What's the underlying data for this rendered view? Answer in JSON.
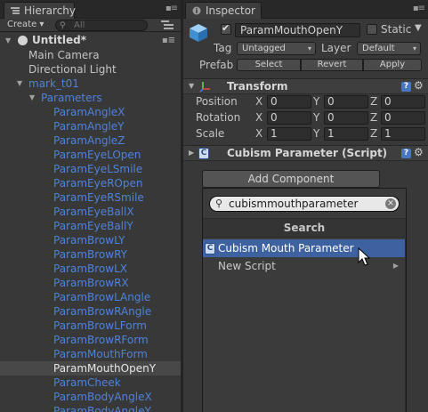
{
  "hierarchy": {
    "tab_label": "Hierarchy",
    "create_label": "Create",
    "search_placeholder": "All",
    "scene": "Untitled*",
    "items": [
      {
        "label": "Main Camera",
        "depth": 1,
        "blue": false,
        "fold": "",
        "selected": false
      },
      {
        "label": "Directional Light",
        "depth": 1,
        "blue": false,
        "fold": "",
        "selected": false
      },
      {
        "label": "mark_t01",
        "depth": 1,
        "blue": true,
        "fold": "open",
        "selected": false
      },
      {
        "label": "Parameters",
        "depth": 2,
        "blue": true,
        "fold": "open",
        "selected": false
      },
      {
        "label": "ParamAngleX",
        "depth": 3,
        "blue": true,
        "fold": "",
        "selected": false
      },
      {
        "label": "ParamAngleY",
        "depth": 3,
        "blue": true,
        "fold": "",
        "selected": false
      },
      {
        "label": "ParamAngleZ",
        "depth": 3,
        "blue": true,
        "fold": "",
        "selected": false
      },
      {
        "label": "ParamEyeLOpen",
        "depth": 3,
        "blue": true,
        "fold": "",
        "selected": false
      },
      {
        "label": "ParamEyeLSmile",
        "depth": 3,
        "blue": true,
        "fold": "",
        "selected": false
      },
      {
        "label": "ParamEyeROpen",
        "depth": 3,
        "blue": true,
        "fold": "",
        "selected": false
      },
      {
        "label": "ParamEyeRSmile",
        "depth": 3,
        "blue": true,
        "fold": "",
        "selected": false
      },
      {
        "label": "ParamEyeBallX",
        "depth": 3,
        "blue": true,
        "fold": "",
        "selected": false
      },
      {
        "label": "ParamEyeBallY",
        "depth": 3,
        "blue": true,
        "fold": "",
        "selected": false
      },
      {
        "label": "ParamBrowLY",
        "depth": 3,
        "blue": true,
        "fold": "",
        "selected": false
      },
      {
        "label": "ParamBrowRY",
        "depth": 3,
        "blue": true,
        "fold": "",
        "selected": false
      },
      {
        "label": "ParamBrowLX",
        "depth": 3,
        "blue": true,
        "fold": "",
        "selected": false
      },
      {
        "label": "ParamBrowRX",
        "depth": 3,
        "blue": true,
        "fold": "",
        "selected": false
      },
      {
        "label": "ParamBrowLAngle",
        "depth": 3,
        "blue": true,
        "fold": "",
        "selected": false
      },
      {
        "label": "ParamBrowRAngle",
        "depth": 3,
        "blue": true,
        "fold": "",
        "selected": false
      },
      {
        "label": "ParamBrowLForm",
        "depth": 3,
        "blue": true,
        "fold": "",
        "selected": false
      },
      {
        "label": "ParamBrowRForm",
        "depth": 3,
        "blue": true,
        "fold": "",
        "selected": false
      },
      {
        "label": "ParamMouthForm",
        "depth": 3,
        "blue": true,
        "fold": "",
        "selected": false
      },
      {
        "label": "ParamMouthOpenY",
        "depth": 3,
        "blue": false,
        "fold": "",
        "selected": true
      },
      {
        "label": "ParamCheek",
        "depth": 3,
        "blue": true,
        "fold": "",
        "selected": false
      },
      {
        "label": "ParamBodyAngleX",
        "depth": 3,
        "blue": true,
        "fold": "",
        "selected": false
      },
      {
        "label": "ParamBodyAngleY",
        "depth": 3,
        "blue": true,
        "fold": "",
        "selected": false
      }
    ]
  },
  "inspector": {
    "tab_label": "Inspector",
    "object_name": "ParamMouthOpenY",
    "active": true,
    "static_label": "Static",
    "static_checked": false,
    "tag_label": "Tag",
    "tag_value": "Untagged",
    "layer_label": "Layer",
    "layer_value": "Default",
    "prefab_label": "Prefab",
    "prefab_buttons": [
      "Select",
      "Revert",
      "Apply"
    ],
    "transform": {
      "title": "Transform",
      "rows": [
        {
          "label": "Position",
          "x": "0",
          "y": "0",
          "z": "0"
        },
        {
          "label": "Rotation",
          "x": "0",
          "y": "0",
          "z": "0"
        },
        {
          "label": "Scale",
          "x": "1",
          "y": "1",
          "z": "1"
        }
      ]
    },
    "cubism_component": "Cubism Parameter (Script)",
    "add_component_label": "Add Component"
  },
  "popup": {
    "search_value": "cubismmouthparameter",
    "title": "Search",
    "items": [
      {
        "label": "Cubism Mouth Parameter",
        "highlighted": true,
        "icon": "cs-script-icon",
        "submenu": false
      },
      {
        "label": "New Script",
        "highlighted": false,
        "icon": "",
        "submenu": true
      }
    ]
  },
  "colors": {
    "panel_bg": "#383838",
    "blue_text": "#4f82d9",
    "selection": "#3e61a0"
  }
}
